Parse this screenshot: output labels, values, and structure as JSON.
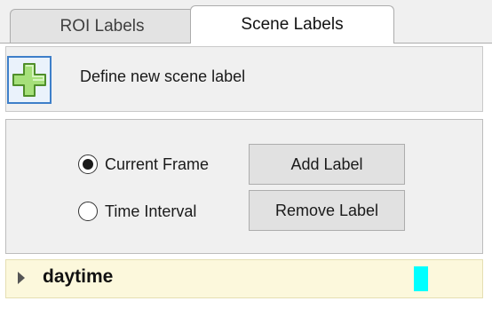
{
  "tabs": [
    {
      "label": "ROI Labels",
      "active": false
    },
    {
      "label": "Scene Labels",
      "active": true
    }
  ],
  "define_scene": {
    "icon": "plus-icon",
    "label": "Define new scene label"
  },
  "controls": {
    "radio_current_frame": {
      "label": "Current Frame",
      "selected": true
    },
    "radio_time_interval": {
      "label": "Time Interval",
      "selected": false
    },
    "add_label_button": "Add Label",
    "remove_label_button": "Remove Label"
  },
  "scene_labels": [
    {
      "name": "daytime",
      "color": "#00FFFF",
      "expanded": false
    }
  ],
  "colors": {
    "plus_icon_fill": "#a6e07a",
    "plus_icon_stroke": "#4f8f2a",
    "selection_border": "#3e7fc9",
    "label_row_bg": "#fcf8dc"
  }
}
